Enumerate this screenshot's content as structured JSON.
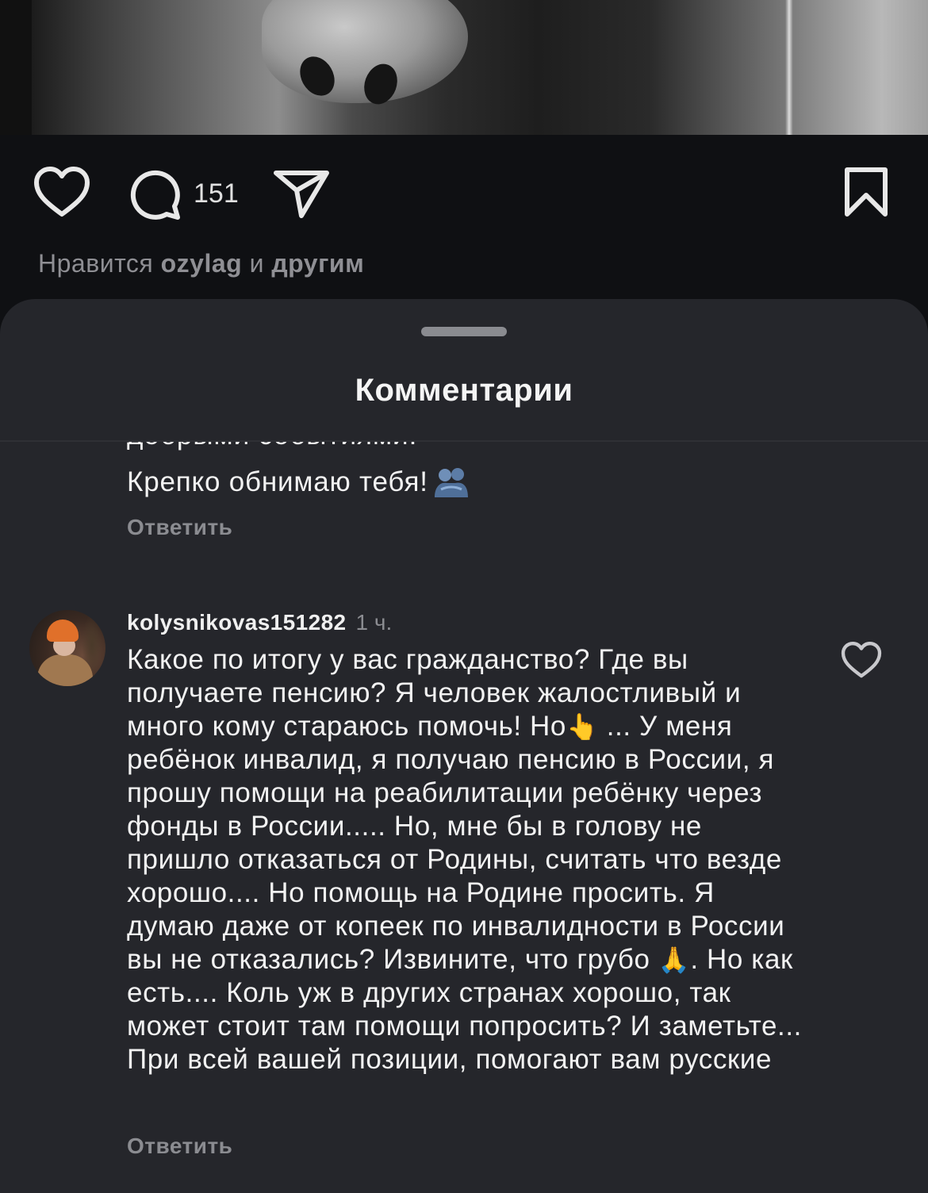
{
  "post": {
    "comment_count": "151",
    "likes": {
      "prefix": "Нравится",
      "user": "ozylag",
      "joiner": "и",
      "others": "другим"
    },
    "caption_peek": ""
  },
  "sheet": {
    "title": "Комментарии"
  },
  "previous_comment": {
    "cut_line": "добрыми событиями.",
    "last_line": "Крепко обнимаю тебя!",
    "reply_label": "Ответить"
  },
  "comment": {
    "username": "kolysnikovas151282",
    "time": "1 ч.",
    "text_part1": "Какое по итогу у вас гражданство? Где вы получаете пенсию? Я человек жалостливый и много кому стараюсь помочь! Но",
    "emoji1": "👆",
    "text_part2": " ... У меня ребёнок инвалид, я получаю пенсию в России, я прошу помощи на реабилитации ребёнку через фонды в России..... Но, мне бы в голову не пришло отказаться от Родины, считать что везде хорошо.... Но помощь на Родине просить. Я думаю даже от копеек по инвалидности в России вы не отказались? Извините, что грубо ",
    "emoji2": "🙏",
    "text_part3": ". Но как есть.... Коль уж в других странах хорошо, так может стоит там помощи попросить? И заметьте... При всей вашей позиции, помогают вам русские",
    "reply_label": "Ответить"
  },
  "icons": {
    "like": "heart-icon",
    "comment": "comment-bubble-icon",
    "share": "paper-plane-icon",
    "save": "bookmark-icon",
    "comment_like": "heart-icon",
    "hug_emoji": "people-hugging-emoji"
  }
}
